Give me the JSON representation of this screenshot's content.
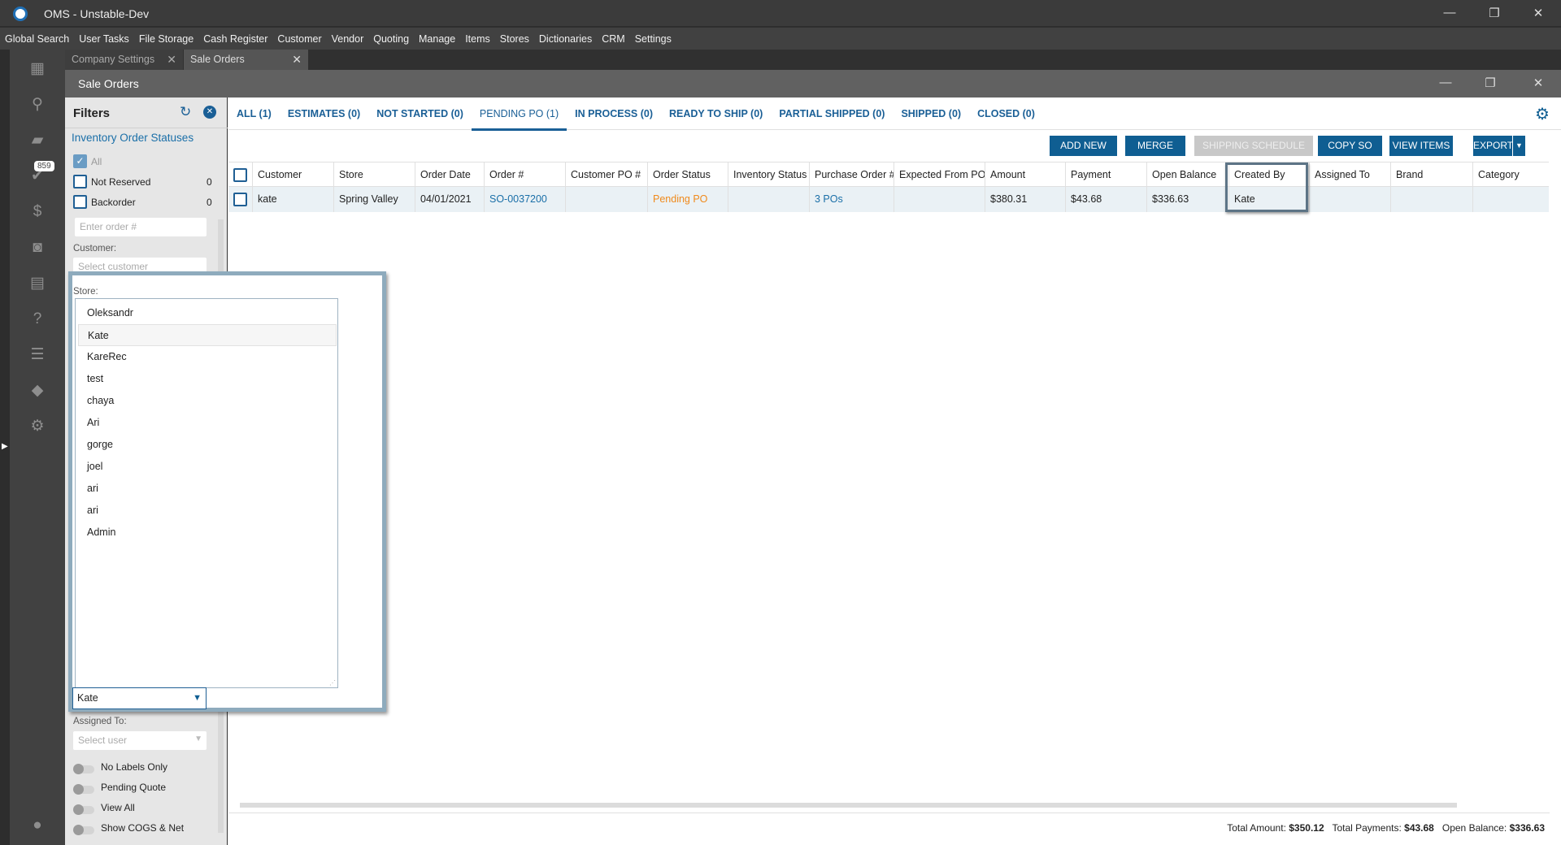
{
  "app": {
    "title": "OMS - Unstable-Dev"
  },
  "menu": [
    "Global Search",
    "User Tasks",
    "File Storage",
    "Cash Register",
    "Customer",
    "Vendor",
    "Quoting",
    "Manage",
    "Items",
    "Stores",
    "Dictionaries",
    "CRM",
    "Settings"
  ],
  "sidebar": {
    "badge": "859"
  },
  "doc_tabs": [
    "Company Settings",
    "Sale Orders"
  ],
  "window": {
    "title": "Sale Orders"
  },
  "filters": {
    "title": "Filters",
    "section": "Inventory Order Statuses",
    "statuses": [
      {
        "label": "All",
        "checked": true,
        "count": ""
      },
      {
        "label": "Not Reserved",
        "checked": false,
        "count": "0"
      },
      {
        "label": "Backorder",
        "checked": false,
        "count": "0"
      }
    ],
    "order_placeholder": "Enter order #",
    "customer_label": "Customer:",
    "customer_placeholder": "Select customer",
    "store_label": "Store:",
    "created_by_value": "Kate",
    "assigned_label": "Assigned To:",
    "assigned_placeholder": "Select user",
    "toggles": [
      "No Labels Only",
      "Pending Quote",
      "View All",
      "Show COGS & Net"
    ]
  },
  "dropdown_options": [
    "Oleksandr",
    "Kate",
    "KareRec",
    "test",
    "chaya",
    "Ari",
    "gorge",
    "joel",
    "ari",
    "ari",
    "Admin"
  ],
  "status_tabs": [
    "ALL (1)",
    "ESTIMATES (0)",
    "NOT STARTED (0)",
    "PENDING PO (1)",
    "IN PROCESS (0)",
    "READY TO SHIP (0)",
    "PARTIAL SHIPPED (0)",
    "SHIPPED (0)",
    "CLOSED (0)"
  ],
  "buttons": [
    "ADD NEW",
    "MERGE",
    "SHIPPING SCHEDULE",
    "COPY SO",
    "VIEW ITEMS",
    "EXPORT"
  ],
  "grid": {
    "columns": [
      "Customer",
      "Store",
      "Order Date",
      "Order #",
      "Customer PO #",
      "Order Status",
      "Inventory Status",
      "Purchase Order #",
      "Expected From PO",
      "Amount",
      "Payment",
      "Open Balance",
      "Created By",
      "Assigned To",
      "Brand",
      "Category"
    ],
    "rows": [
      [
        "kate",
        "Spring Valley",
        "04/01/2021",
        "SO-0037200",
        "",
        "Pending PO",
        "",
        "3 POs",
        "",
        "$380.31",
        "$43.68",
        "$336.63",
        "Kate",
        "",
        "",
        ""
      ]
    ]
  },
  "footer": {
    "total_amount_label": "Total Amount:",
    "total_amount": "$350.12",
    "total_payments_label": "Total Payments:",
    "total_payments": "$43.68",
    "open_balance_label": "Open Balance:",
    "open_balance": "$336.63"
  },
  "colors": {
    "accent": "#0f5e92",
    "status_pending": "#f08a1c"
  }
}
